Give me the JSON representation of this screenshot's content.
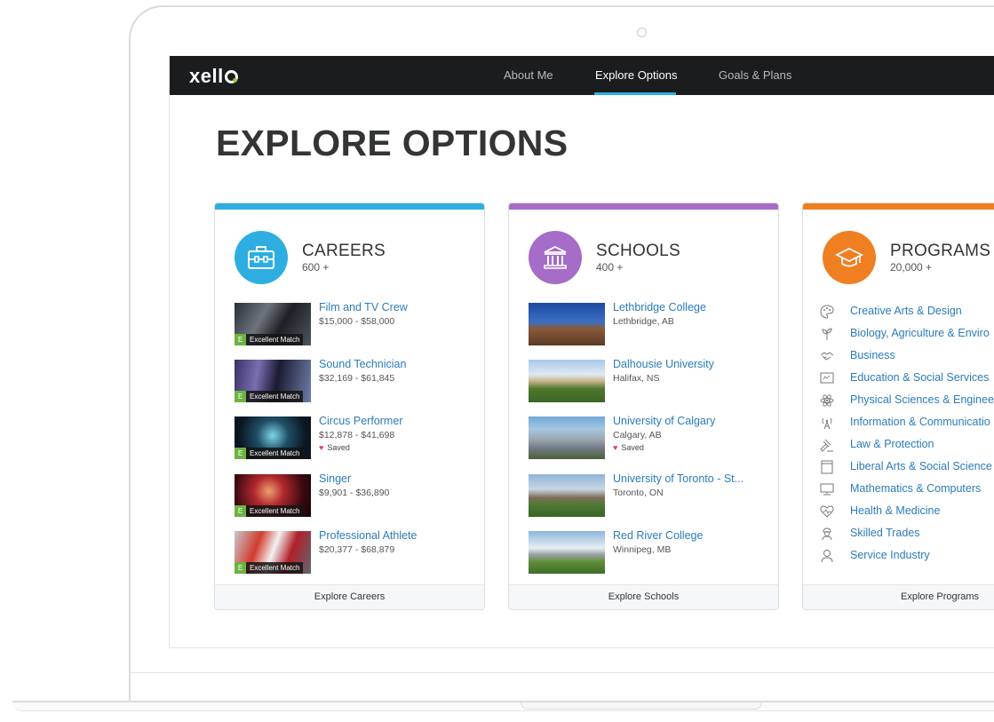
{
  "app": {
    "logo": "xello",
    "nav": [
      "About Me",
      "Explore Options",
      "Goals & Plans"
    ],
    "active_tab": "Explore Options"
  },
  "page_title": "EXPLORE OPTIONS",
  "colors": {
    "careers": "#2eaee0",
    "schools": "#a56cc8",
    "programs": "#f07f22",
    "link": "#2b7bb9",
    "match": "#6cb33f",
    "nav_bg": "#1b1c1d"
  },
  "careers": {
    "title": "CAREERS",
    "count": "600 +",
    "icon": "briefcase-icon",
    "footer": "Explore Careers",
    "items": [
      {
        "title": "Film and TV Crew",
        "salary": "$15,000 - $58,000",
        "badge_letter": "E",
        "badge": "Excellent Match",
        "saved": ""
      },
      {
        "title": "Sound Technician",
        "salary": "$32,169 - $61,845",
        "badge_letter": "E",
        "badge": "Excellent Match",
        "saved": ""
      },
      {
        "title": "Circus Performer",
        "salary": "$12,878 - $41,698",
        "badge_letter": "E",
        "badge": "Excellent Match",
        "saved": "Saved"
      },
      {
        "title": "Singer",
        "salary": "$9,901 - $36,890",
        "badge_letter": "E",
        "badge": "Excellent Match",
        "saved": ""
      },
      {
        "title": "Professional Athlete",
        "salary": "$20,377 - $68,879",
        "badge_letter": "E",
        "badge": "Excellent Match",
        "saved": ""
      }
    ]
  },
  "schools": {
    "title": "SCHOOLS",
    "count": "400 +",
    "icon": "institution-icon",
    "footer": "Explore Schools",
    "items": [
      {
        "title": "Lethbridge College",
        "location": "Lethbridge, AB",
        "saved": ""
      },
      {
        "title": "Dalhousie University",
        "location": "Halifax, NS",
        "saved": ""
      },
      {
        "title": "University of Calgary",
        "location": "Calgary, AB",
        "saved": "Saved"
      },
      {
        "title": "University of Toronto - St...",
        "location": "Toronto, ON",
        "saved": ""
      },
      {
        "title": "Red River College",
        "location": "Winnipeg, MB",
        "saved": ""
      }
    ]
  },
  "programs": {
    "title": "PROGRAMS",
    "count": "20,000 +",
    "icon": "graduation-cap-icon",
    "footer": "Explore Programs",
    "items": [
      {
        "label": "Creative Arts & Design",
        "icon": "palette-icon"
      },
      {
        "label": "Biology, Agriculture & Enviro",
        "icon": "plant-icon"
      },
      {
        "label": "Business",
        "icon": "handshake-icon"
      },
      {
        "label": "Education & Social Services",
        "icon": "chalkboard-icon"
      },
      {
        "label": "Physical Sciences & Enginee",
        "icon": "atom-icon"
      },
      {
        "label": "Information & Communicatio",
        "icon": "antenna-icon"
      },
      {
        "label": "Law & Protection",
        "icon": "gavel-icon"
      },
      {
        "label": "Liberal Arts & Social Science",
        "icon": "book-icon"
      },
      {
        "label": "Mathematics & Computers",
        "icon": "monitor-icon"
      },
      {
        "label": "Health & Medicine",
        "icon": "heartbeat-icon"
      },
      {
        "label": "Skilled Trades",
        "icon": "worker-icon"
      },
      {
        "label": "Service Industry",
        "icon": "person-icon"
      }
    ]
  }
}
